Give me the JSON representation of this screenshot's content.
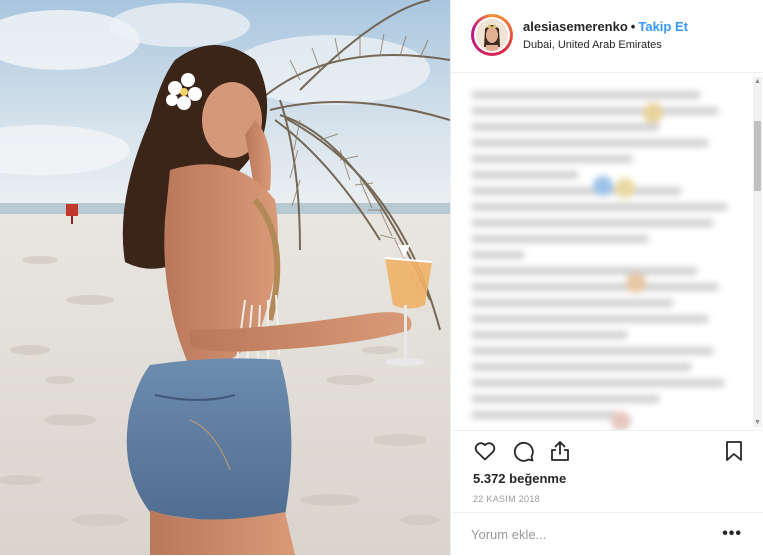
{
  "post": {
    "username": "alesiasemerenko",
    "separator": "•",
    "follow_label": "Takip Et",
    "location": "Dubai, United Arab Emirates",
    "likes_text": "5.372 beğenme",
    "date_text": "22 KASIM 2018",
    "comment_placeholder": "Yorum ekle...",
    "more_label": "•••"
  },
  "icons": {
    "like": "heart-icon",
    "comment": "speech-bubble-icon",
    "share": "share-icon",
    "save": "bookmark-icon"
  },
  "colors": {
    "accent": "#3897f0",
    "text": "#262626",
    "muted": "#999999",
    "border": "#efefef"
  }
}
